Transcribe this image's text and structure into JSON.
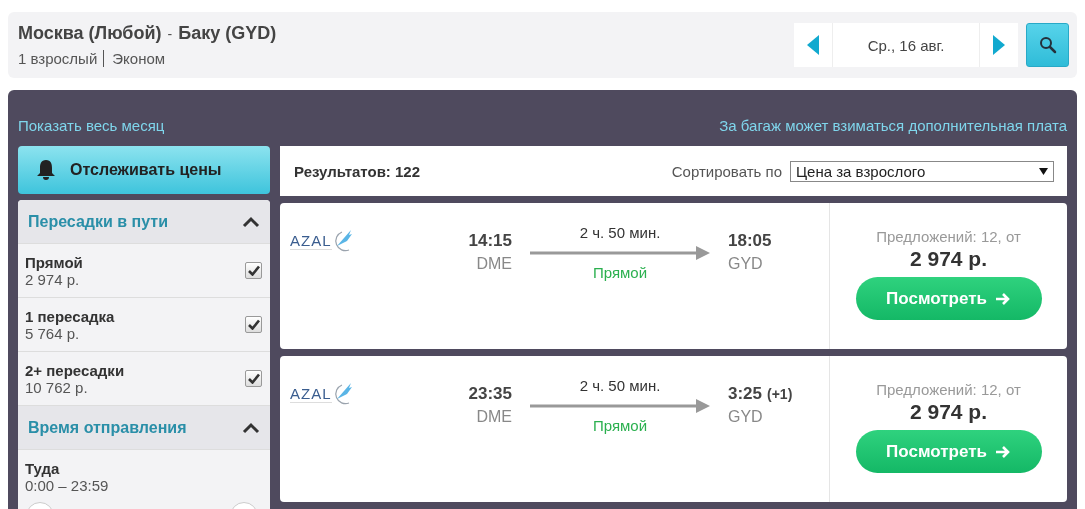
{
  "search_summary": {
    "route_from": "Москва (Любой)",
    "route_separator": "-",
    "route_to": "Баку (GYD)",
    "passengers": "1 взрослый",
    "cabin_class": "Эконом",
    "date": "Ср., 16 авг."
  },
  "links": {
    "show_month": "Показать весь месяц",
    "baggage_note": "За багаж может взиматься дополнительная плата"
  },
  "track_prices_button": "Отслеживать цены",
  "filters": [
    {
      "title": "Пересадки в пути",
      "expanded": true,
      "kind": "checkboxes",
      "options": [
        {
          "label": "Прямой",
          "price": "2 974 р.",
          "checked": true
        },
        {
          "label": "1 пересадка",
          "price": "5 764 р.",
          "checked": true
        },
        {
          "label": "2+ пересадки",
          "price": "10 762 р.",
          "checked": true
        }
      ]
    },
    {
      "title": "Время отправления",
      "expanded": true,
      "kind": "time_range",
      "ranges": [
        {
          "label": "Туда",
          "value": "0:00 – 23:59"
        }
      ]
    }
  ],
  "results": {
    "count_label": "Результатов: 122",
    "sort_label": "Сортировать по",
    "sort_value": "Цена за взрослого"
  },
  "flights": [
    {
      "airline": "AZAL",
      "depart_time": "14:15",
      "depart_airport": "DME",
      "duration": "2 ч. 50 мин.",
      "stops": "Прямой",
      "arrive_time": "18:05",
      "arrive_airport": "GYD",
      "offers": "Предложений: 12, от",
      "price": "2 974 р.",
      "button": "Посмотреть"
    },
    {
      "airline": "AZAL",
      "depart_time": "23:35",
      "depart_airport": "DME",
      "duration": "2 ч. 50 мин.",
      "stops": "Прямой",
      "arrive_time": "3:25",
      "arrive_day_offset": "(+1)",
      "arrive_airport": "GYD",
      "offers": "Предложений: 12, от",
      "price": "2 974 р.",
      "button": "Посмотреть"
    }
  ]
}
